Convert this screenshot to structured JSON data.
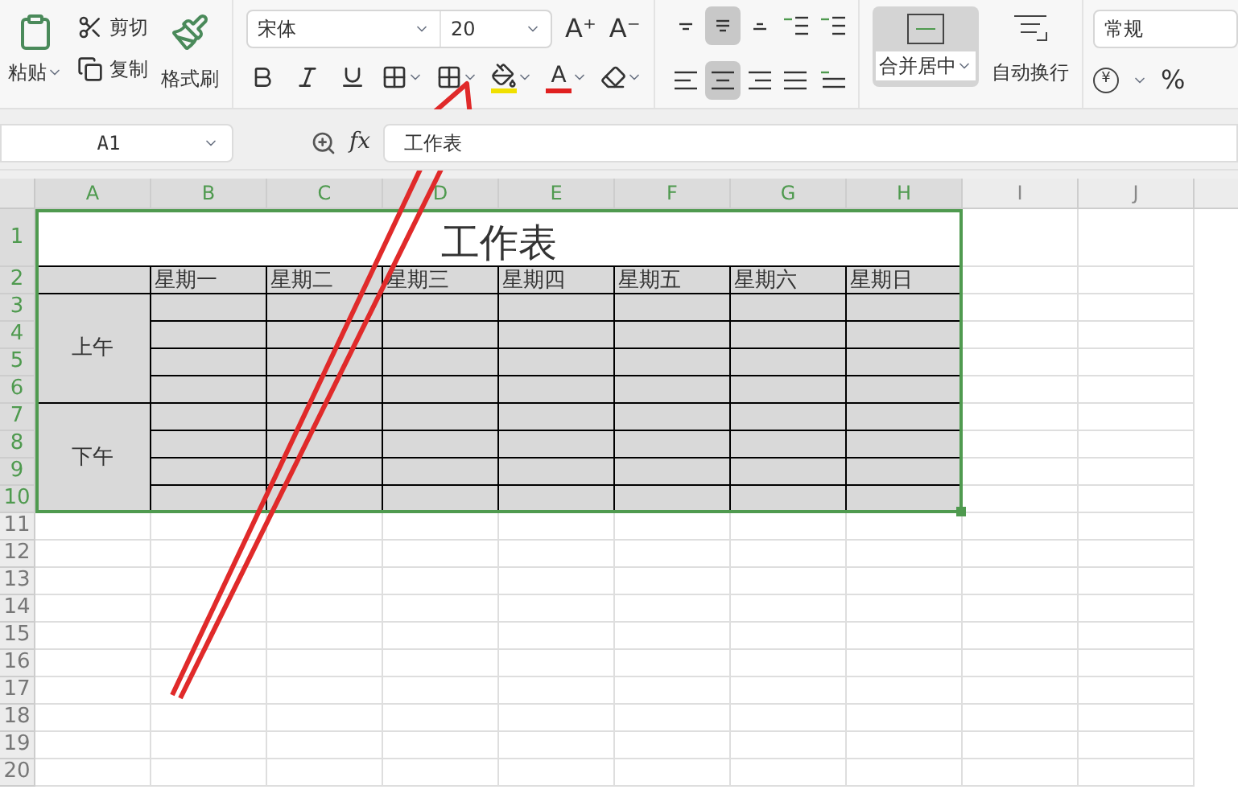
{
  "ribbon": {
    "clipboard": {
      "paste": "粘贴",
      "cut": "剪切",
      "copy": "复制",
      "format_painter": "格式刷"
    },
    "font": {
      "name": "宋体",
      "size": "20",
      "grow": "A⁺",
      "shrink": "A⁻",
      "bold": false,
      "italic": false,
      "underline": false,
      "color_letter": "A"
    },
    "alignment": [
      {
        "kind": "top",
        "selected": false
      },
      {
        "kind": "middle",
        "selected": true
      },
      {
        "kind": "bottom",
        "selected": false
      },
      {
        "kind": "outdent",
        "selected": false
      },
      {
        "kind": "indent",
        "selected": false
      },
      {
        "kind": "left",
        "selected": false
      },
      {
        "kind": "center",
        "selected": true
      },
      {
        "kind": "right",
        "selected": false
      },
      {
        "kind": "justify",
        "selected": false
      },
      {
        "kind": "distribute",
        "selected": false
      }
    ],
    "merge": {
      "label": "合并居中",
      "selected": true
    },
    "wrap": {
      "label": "自动换行",
      "selected": false
    },
    "number_format": {
      "value": "常规",
      "currency": "¥",
      "percent": "%"
    }
  },
  "formula_bar": {
    "name_box": "A1",
    "fx": "fx",
    "value": "工作表"
  },
  "sheet": {
    "columns": [
      {
        "label": "A",
        "selected": true
      },
      {
        "label": "B",
        "selected": true
      },
      {
        "label": "C",
        "selected": true
      },
      {
        "label": "D",
        "selected": true
      },
      {
        "label": "E",
        "selected": true
      },
      {
        "label": "F",
        "selected": true
      },
      {
        "label": "G",
        "selected": true
      },
      {
        "label": "H",
        "selected": true
      },
      {
        "label": "I",
        "selected": false
      },
      {
        "label": "J",
        "selected": false
      }
    ],
    "rows": [
      {
        "label": "1",
        "selected": true
      },
      {
        "label": "2",
        "selected": true
      },
      {
        "label": "3",
        "selected": true
      },
      {
        "label": "4",
        "selected": true
      },
      {
        "label": "5",
        "selected": true
      },
      {
        "label": "6",
        "selected": true
      },
      {
        "label": "7",
        "selected": true
      },
      {
        "label": "8",
        "selected": true
      },
      {
        "label": "9",
        "selected": true
      },
      {
        "label": "10",
        "selected": true
      },
      {
        "label": "11",
        "selected": false
      },
      {
        "label": "12",
        "selected": false
      },
      {
        "label": "13",
        "selected": false
      },
      {
        "label": "14",
        "selected": false
      },
      {
        "label": "15",
        "selected": false
      },
      {
        "label": "16",
        "selected": false
      },
      {
        "label": "17",
        "selected": false
      },
      {
        "label": "18",
        "selected": false
      },
      {
        "label": "19",
        "selected": false
      },
      {
        "label": "20",
        "selected": false
      }
    ],
    "title": "工作表",
    "weekdays": [
      "星期一",
      "星期二",
      "星期三",
      "星期四",
      "星期五",
      "星期六",
      "星期日"
    ],
    "periods": [
      "上午",
      "下午"
    ]
  }
}
